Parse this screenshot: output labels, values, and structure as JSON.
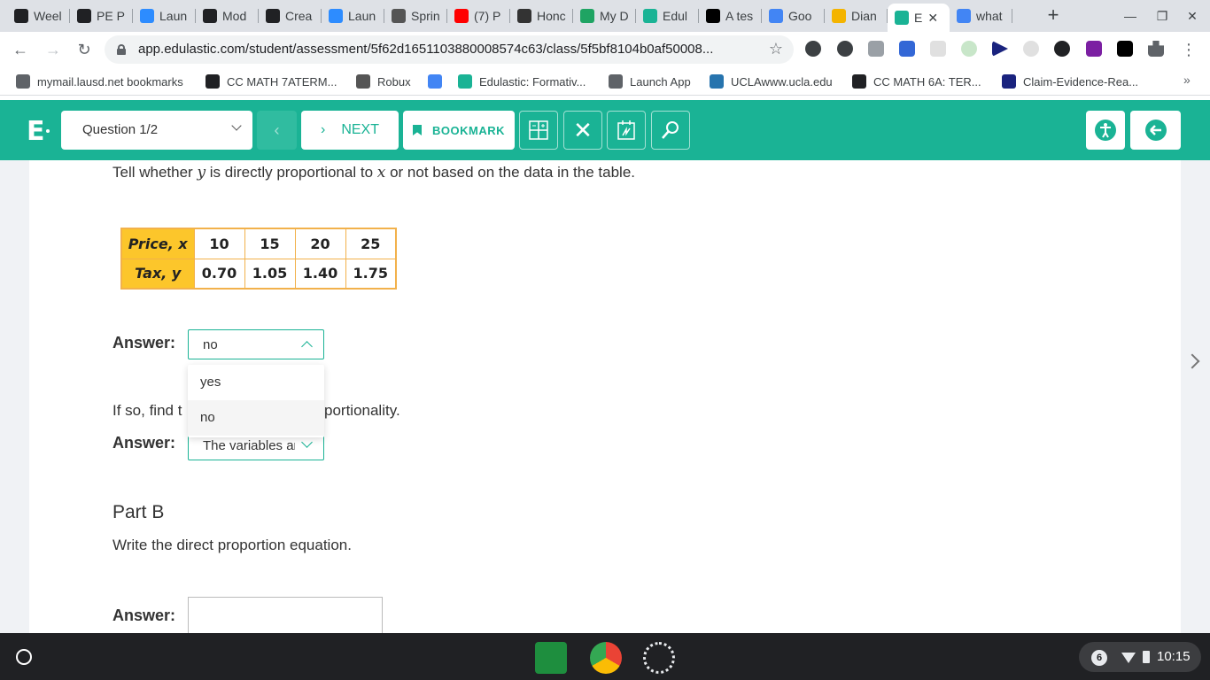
{
  "browser": {
    "tabs": [
      {
        "title": "Weel",
        "icon": "s-icon",
        "color": "#202124"
      },
      {
        "title": "PE P",
        "icon": "s-icon",
        "color": "#202124"
      },
      {
        "title": "Laun",
        "icon": "zoom-icon",
        "color": "#2d8cff"
      },
      {
        "title": "Mod",
        "icon": "s-icon",
        "color": "#202124"
      },
      {
        "title": "Crea",
        "icon": "s-icon",
        "color": "#202124"
      },
      {
        "title": "Laun",
        "icon": "zoom-icon",
        "color": "#2d8cff"
      },
      {
        "title": "Sprin",
        "icon": "shield-icon",
        "color": "#555"
      },
      {
        "title": "(7) P",
        "icon": "youtube-icon",
        "color": "#ff0000"
      },
      {
        "title": "Honc",
        "icon": "contact-icon",
        "color": "#333"
      },
      {
        "title": "My D",
        "icon": "drive-icon",
        "color": "#1fa463"
      },
      {
        "title": "Edul",
        "icon": "edulastic-icon",
        "color": "#1ab395"
      },
      {
        "title": "A tes",
        "icon": "b-icon",
        "color": "#000"
      },
      {
        "title": "Goo",
        "icon": "docs-icon",
        "color": "#4285f4"
      },
      {
        "title": "Dian",
        "icon": "slides-icon",
        "color": "#f4b400"
      },
      {
        "title": "E",
        "icon": "edulastic-icon",
        "color": "#1ab395",
        "active": true
      },
      {
        "title": "what",
        "icon": "google-icon",
        "color": "#4285f4"
      }
    ],
    "url": "app.edulastic.com/student/assessment/5f62d1651103880008574c63/class/5f5bf8104b0af50008...",
    "bookmarks": [
      {
        "label": "mymail.lausd.net bookmarks",
        "icon": "folder-icon"
      },
      {
        "label": "CC MATH 7ATERM...",
        "icon": "s-icon"
      },
      {
        "label": "Robux",
        "icon": "roblox-icon"
      },
      {
        "label": "",
        "icon": "google-icon"
      },
      {
        "label": "Edulastic: Formativ...",
        "icon": "edulastic-icon"
      },
      {
        "label": "Launch App",
        "icon": "globe-icon"
      },
      {
        "label": "UCLAwww.ucla.edu",
        "icon": "ucla-icon"
      },
      {
        "label": "CC MATH 6A: TER...",
        "icon": "s-icon"
      },
      {
        "label": "Claim-Evidence-Rea...",
        "icon": "m-icon"
      }
    ]
  },
  "header": {
    "logo": "E",
    "question_select": "Question 1/2",
    "next_label": "NEXT",
    "bookmark_label": "BOOKMARK",
    "brand_color": "#1ab395"
  },
  "question": {
    "text_prefix": "Tell whether ",
    "var_y": "y",
    "text_mid": " is directly proportional to ",
    "var_x": "x",
    "text_suffix": " or not based on the data in the table.",
    "table": {
      "row1_header": "Price, x",
      "row1": [
        "10",
        "15",
        "20",
        "25"
      ],
      "row2_header": "Tax, y",
      "row2": [
        "0.70",
        "1.05",
        "1.40",
        "1.75"
      ]
    },
    "answer_label": "Answer:",
    "answer1_value": "no",
    "options": [
      "yes",
      "no"
    ],
    "followup_left": "If so, find t",
    "followup_right": "portionality.",
    "answer2_value": "The variables ar",
    "part_b_heading": "Part B",
    "part_b_text": "Write the direct proportion equation."
  },
  "shelf": {
    "notification_count": "6",
    "time": "10:15"
  }
}
